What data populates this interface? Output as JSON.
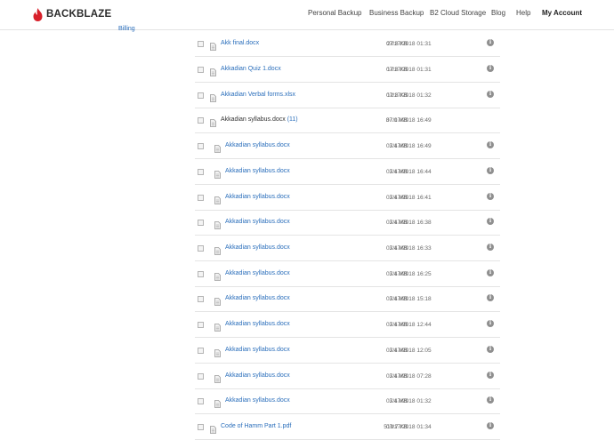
{
  "header": {
    "brand": "BACKBLAZE",
    "nav": [
      "Personal Backup",
      "Business Backup",
      "B2 Cloud Storage",
      "Blog",
      "Help",
      "My Account"
    ]
  },
  "sidebar": {
    "link": "Billing"
  },
  "info_symbol": "i",
  "files": [
    {
      "name": "Akk final.docx",
      "size": "27.8 KB",
      "date": "07/17/2018 01:31",
      "version": false,
      "info": true
    },
    {
      "name": "Akkadian Quiz 1.docx",
      "size": "17.8 KB",
      "date": "07/17/2018 01:31",
      "version": false,
      "info": true
    },
    {
      "name": "Akkadian Verbal forms.xlsx",
      "size": "12.8 KB",
      "date": "07/17/2018 01:32",
      "version": false,
      "info": true
    },
    {
      "name": "Akkadian syllabus.docx",
      "count": "(11)",
      "size": "37.0 MB",
      "date": "07/17/2018 16:49",
      "version": false,
      "group": true,
      "info": false
    },
    {
      "name": "Akkadian syllabus.docx",
      "size": "3.4 MB",
      "date": "07/17/2018 16:49",
      "version": true,
      "info": true
    },
    {
      "name": "Akkadian syllabus.docx",
      "size": "3.4 MB",
      "date": "07/17/2018 16:44",
      "version": true,
      "info": true
    },
    {
      "name": "Akkadian syllabus.docx",
      "size": "3.4 MB",
      "date": "07/17/2018 16:41",
      "version": true,
      "info": true
    },
    {
      "name": "Akkadian syllabus.docx",
      "size": "3.4 MB",
      "date": "07/17/2018 16:38",
      "version": true,
      "info": true
    },
    {
      "name": "Akkadian syllabus.docx",
      "size": "3.4 MB",
      "date": "07/17/2018 16:33",
      "version": true,
      "info": true
    },
    {
      "name": "Akkadian syllabus.docx",
      "size": "3.4 MB",
      "date": "07/17/2018 16:25",
      "version": true,
      "info": true
    },
    {
      "name": "Akkadian syllabus.docx",
      "size": "3.4 MB",
      "date": "07/17/2018 15:18",
      "version": true,
      "info": true
    },
    {
      "name": "Akkadian syllabus.docx",
      "size": "3.4 MB",
      "date": "07/17/2018 12:44",
      "version": true,
      "info": true
    },
    {
      "name": "Akkadian syllabus.docx",
      "size": "3.4 MB",
      "date": "07/17/2018 12:05",
      "version": true,
      "info": true
    },
    {
      "name": "Akkadian syllabus.docx",
      "size": "3.4 MB",
      "date": "07/17/2018 07:28",
      "version": true,
      "info": true
    },
    {
      "name": "Akkadian syllabus.docx",
      "size": "3.4 MB",
      "date": "07/17/2018 01:32",
      "version": true,
      "info": true
    },
    {
      "name": "Code of Hamm Part 1.pdf",
      "size": "519.7 KB",
      "date": "07/17/2018 01:34",
      "version": false,
      "info": true
    }
  ]
}
